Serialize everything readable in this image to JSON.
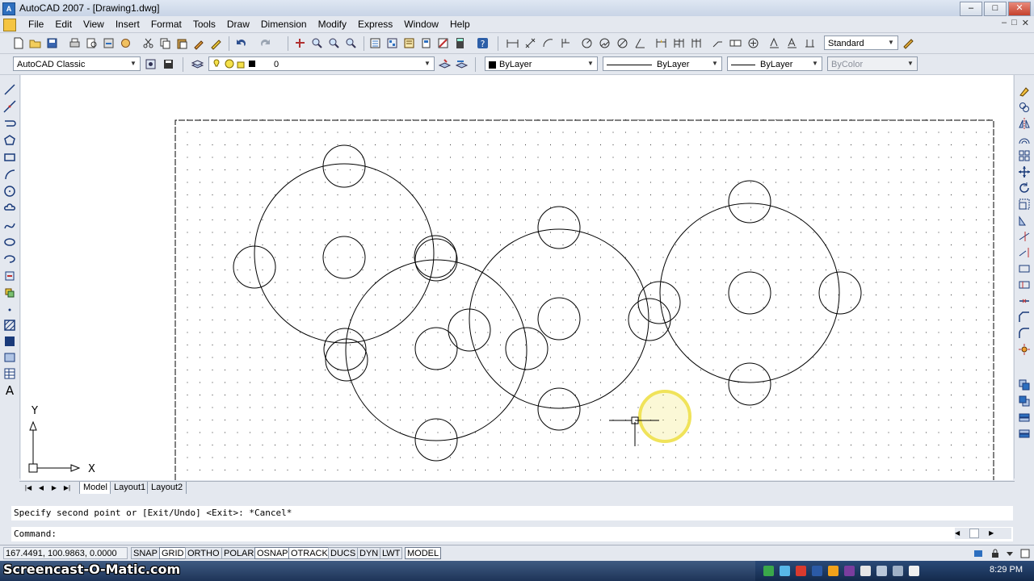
{
  "window": {
    "title": "AutoCAD 2007 - [Drawing1.dwg]",
    "buttons": [
      "–",
      "□",
      "✕"
    ],
    "mdi_buttons": [
      "–",
      "□",
      "✕"
    ]
  },
  "menu": {
    "items": [
      "File",
      "Edit",
      "View",
      "Insert",
      "Format",
      "Tools",
      "Draw",
      "Dimension",
      "Modify",
      "Express",
      "Window",
      "Help"
    ]
  },
  "toolbar": {
    "text_style": "Standard",
    "workspace": "AutoCAD Classic",
    "layer": "0",
    "color": "ByLayer",
    "linetype": "ByLayer",
    "lineweight": "ByLayer",
    "plotstyle": "ByColor"
  },
  "layout_tabs": {
    "tabs": [
      "Model",
      "Layout1",
      "Layout2"
    ],
    "active": "Model"
  },
  "command": {
    "history": "Specify second point or [Exit/Undo] <Exit>: *Cancel*",
    "prompt": "Command:"
  },
  "ucs": {
    "x_label": "X",
    "y_label": "Y"
  },
  "status": {
    "coordinates": "167.4491, 100.9863, 0.0000",
    "toggles": [
      {
        "label": "SNAP",
        "on": false
      },
      {
        "label": "GRID",
        "on": true
      },
      {
        "label": "ORTHO",
        "on": false
      },
      {
        "label": "POLAR",
        "on": false
      },
      {
        "label": "OSNAP",
        "on": true
      },
      {
        "label": "OTRACK",
        "on": true
      },
      {
        "label": "DUCS",
        "on": false
      },
      {
        "label": "DYN",
        "on": false
      },
      {
        "label": "LWT",
        "on": false
      },
      {
        "label": "MODEL",
        "on": true
      }
    ]
  },
  "taskbar": {
    "watermark": "Screencast-O-Matic.com",
    "clock": "8:29 PM"
  },
  "colors": {
    "cursor_highlight": "#f0e35a",
    "accent": "#2d6fbf",
    "circle_stroke": "#000000"
  }
}
